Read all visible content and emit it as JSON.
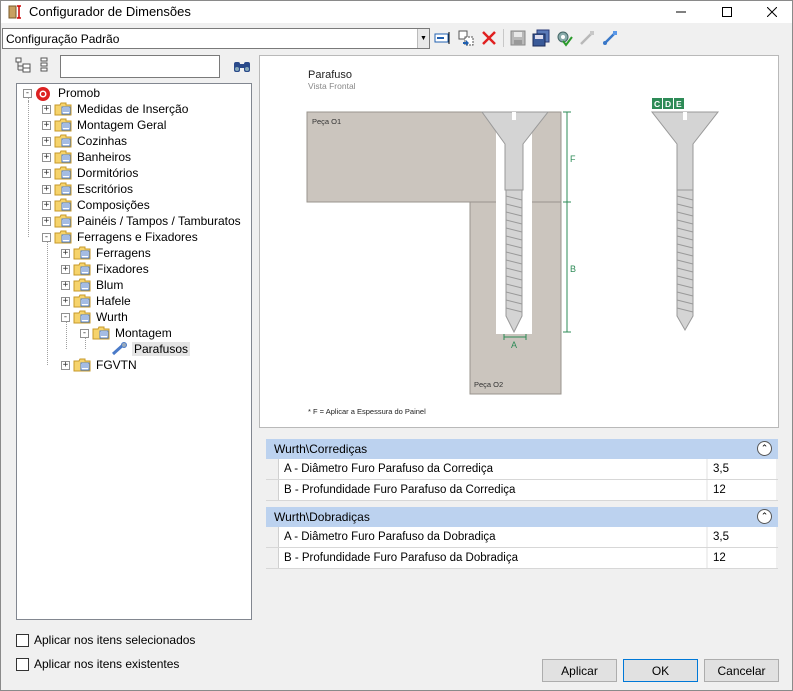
{
  "window": {
    "title": "Configurador de Dimensões"
  },
  "config": {
    "selected": "Configuração Padrão"
  },
  "search": {
    "value": ""
  },
  "tree": [
    {
      "label": "Promob",
      "level": 0,
      "state": "-",
      "icon": "promob-logo-icon"
    },
    {
      "label": "Medidas de Inserção",
      "level": 1,
      "state": "+"
    },
    {
      "label": "Montagem Geral",
      "level": 1,
      "state": "+"
    },
    {
      "label": "Cozinhas",
      "level": 1,
      "state": "+"
    },
    {
      "label": "Banheiros",
      "level": 1,
      "state": "+"
    },
    {
      "label": "Dormitórios",
      "level": 1,
      "state": "+"
    },
    {
      "label": "Escritórios",
      "level": 1,
      "state": "+"
    },
    {
      "label": "Composições",
      "level": 1,
      "state": "+"
    },
    {
      "label": "Painéis / Tampos / Tamburatos",
      "level": 1,
      "state": "+"
    },
    {
      "label": "Ferragens e Fixadores",
      "level": 1,
      "state": "-"
    },
    {
      "label": "Ferragens",
      "level": 2,
      "state": "+"
    },
    {
      "label": "Fixadores",
      "level": 2,
      "state": "+"
    },
    {
      "label": "Blum",
      "level": 2,
      "state": "+"
    },
    {
      "label": "Hafele",
      "level": 2,
      "state": "+"
    },
    {
      "label": "Wurth",
      "level": 2,
      "state": "-"
    },
    {
      "label": "Montagem",
      "level": 3,
      "state": "-"
    },
    {
      "label": "Parafusos",
      "level": 4,
      "state": "",
      "selected": true,
      "icon": "screw-item-icon"
    },
    {
      "label": "FGVTN",
      "level": 2,
      "state": "+"
    }
  ],
  "preview": {
    "title": "Parafuso",
    "subtitle": "Vista Frontal",
    "peca1": "Peça O1",
    "peca2": "Peça O2",
    "dim_f": "F",
    "dim_b": "B",
    "dim_a": "A",
    "badge_c": "C",
    "badge_d": "D",
    "badge_e": "E",
    "footnote": "* F = Aplicar a Espessura do Painel"
  },
  "groups": [
    {
      "title": "Wurth\\Corrediças",
      "rows": [
        {
          "name": "A - Diâmetro Furo Parafuso da Corrediça",
          "value": "3,5"
        },
        {
          "name": "B - Profundidade Furo Parafuso da Corrediça",
          "value": "12"
        }
      ]
    },
    {
      "title": "Wurth\\Dobradiças",
      "rows": [
        {
          "name": "A - Diâmetro Furo Parafuso da Dobradiça",
          "value": "3,5"
        },
        {
          "name": "B - Profundidade Furo Parafuso da Dobradiça",
          "value": "12"
        }
      ]
    }
  ],
  "options": {
    "apply_selected": "Aplicar nos itens selecionados",
    "apply_existing": "Aplicar nos itens existentes"
  },
  "buttons": {
    "apply": "Aplicar",
    "ok": "OK",
    "cancel": "Cancelar"
  },
  "colors": {
    "accent_green": "#2e8b57",
    "group_header": "#bcd2ef",
    "wood": "#cbc5be"
  }
}
